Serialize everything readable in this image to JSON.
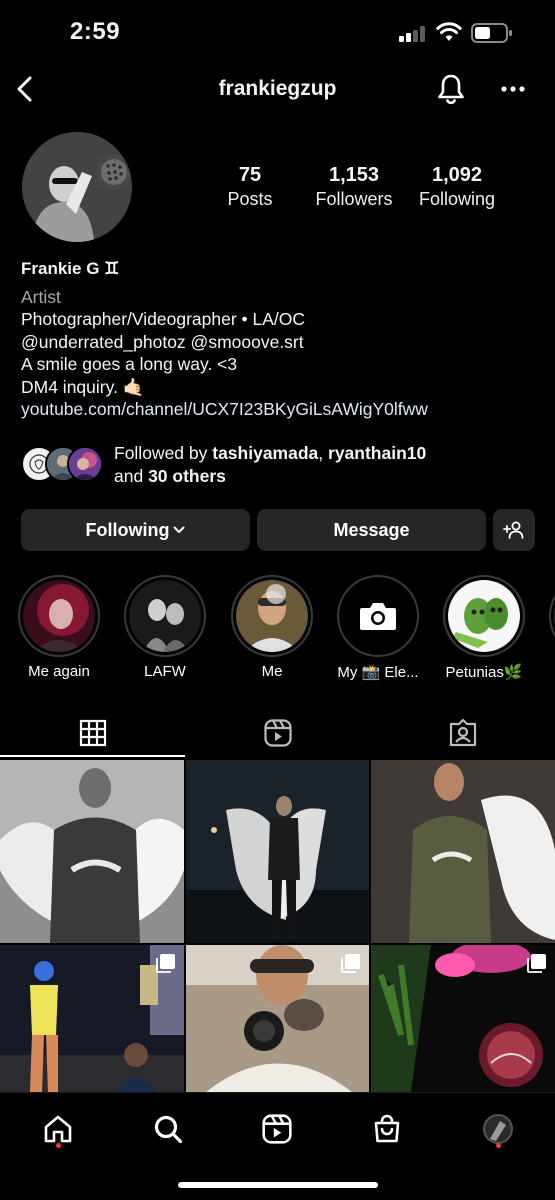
{
  "status_bar": {
    "time": "2:59"
  },
  "header": {
    "username": "frankiegzup"
  },
  "profile": {
    "stats": [
      {
        "value": "75",
        "label": "Posts"
      },
      {
        "value": "1,153",
        "label": "Followers"
      },
      {
        "value": "1,092",
        "label": "Following"
      }
    ],
    "name": "Frankie G ♊︎",
    "category": "Artist",
    "bio_lines": [
      "Photographer/Videographer • LA/OC",
      "@underrated_photoz @smooove.srt",
      "A smile goes a long way. <3",
      "DM4 inquiry. 🤙🏻"
    ],
    "link": "youtube.com/channel/UCX7I23BKyGiLsAWigY0lfww"
  },
  "followed_by": {
    "prefix": "Followed by ",
    "user1": "tashiyamada",
    "separator": ", ",
    "user2": "ryanthain10",
    "and_text": "and ",
    "others": "30 others"
  },
  "actions": {
    "following_label": "Following",
    "message_label": "Message"
  },
  "highlights": [
    {
      "label": "Me again"
    },
    {
      "label": "LAFW"
    },
    {
      "label": "Me"
    },
    {
      "label": "My 📸 Ele..."
    },
    {
      "label": "Petunias🌿"
    }
  ],
  "tabs": [
    "grid-icon",
    "reels-icon",
    "tagged-icon"
  ],
  "bottom_nav": [
    "home-icon",
    "search-icon",
    "reels-icon",
    "shop-icon",
    "profile-avatar"
  ],
  "colors": {
    "background": "#000000",
    "button": "#262626",
    "notification_dot": "#ff3040",
    "muted_text": "#a8a8a8"
  }
}
